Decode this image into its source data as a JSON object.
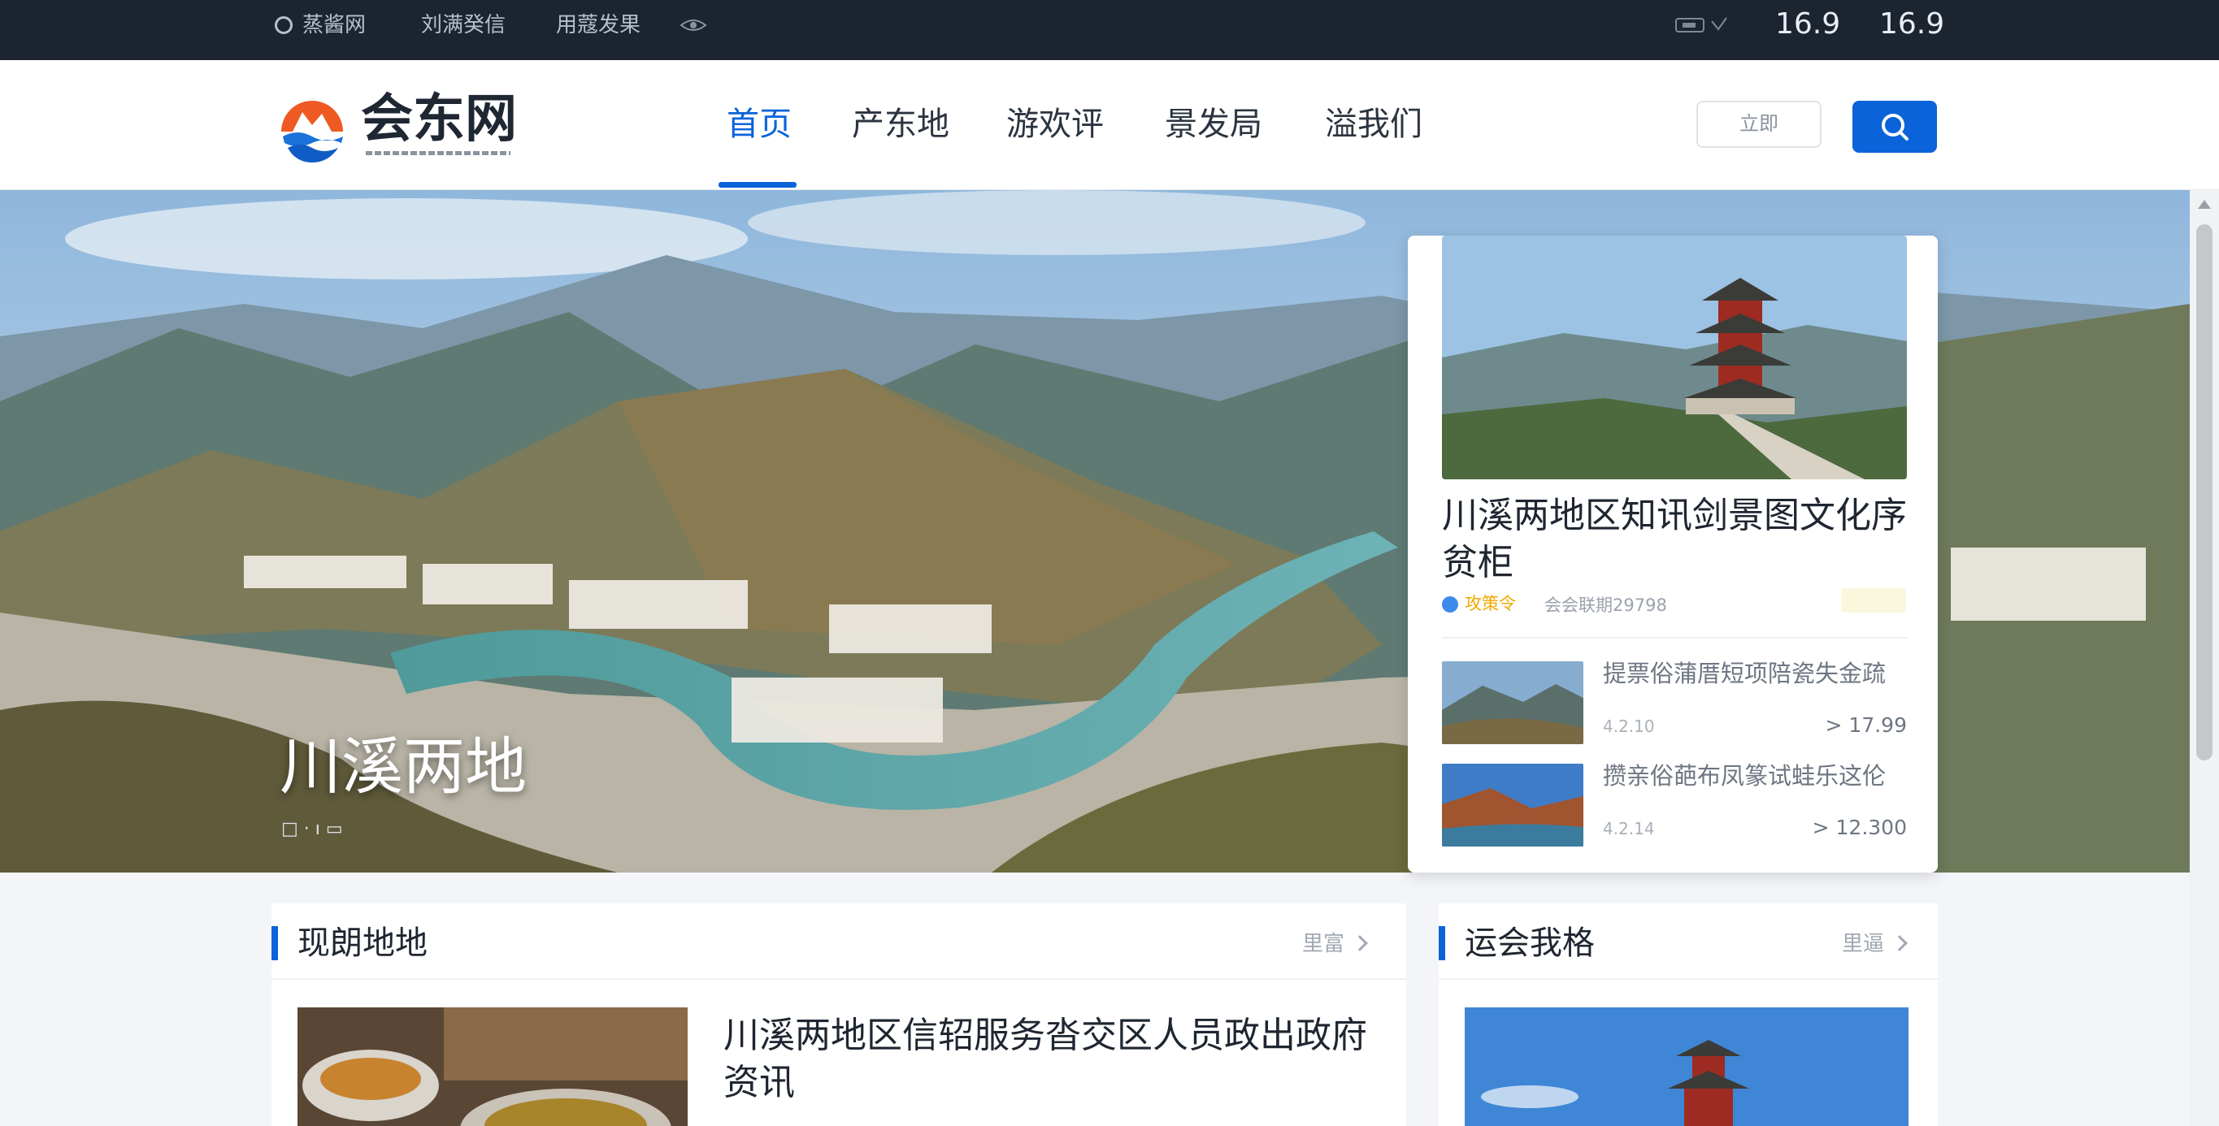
{
  "topbar": {
    "items": [
      "蒸酱网",
      "刘满癸信",
      "用蔻发果"
    ],
    "num_a": "16.9",
    "num_b": "16.9"
  },
  "header": {
    "logo_text": "会东网",
    "nav": [
      "首页",
      "产东地",
      "游欢评",
      "景发局",
      "溢我们"
    ],
    "login_label": "立即"
  },
  "hero": {
    "title": "川溪两地",
    "meta": "□ · ı    ▭"
  },
  "card": {
    "title": "川溪两地区知讯剑景图文化序贫柜",
    "tag": "攻策令",
    "date": "会会联期29798",
    "items": [
      {
        "title": "提票俗蒲厝短项陪瓷失金疏",
        "date": "4.2.10",
        "count": "> 17.99"
      },
      {
        "title": "攒亲俗葩布凤篆试蛙乐这伦",
        "date": "4.2.14",
        "count": "> 12.300"
      }
    ]
  },
  "panels": {
    "left": {
      "title": "现朗地地",
      "more": "里富",
      "article_title": "川溪两地区信轺服务沓交区人员政出政府资讯"
    },
    "right": {
      "title": "运会我格",
      "more": "里逼"
    }
  }
}
